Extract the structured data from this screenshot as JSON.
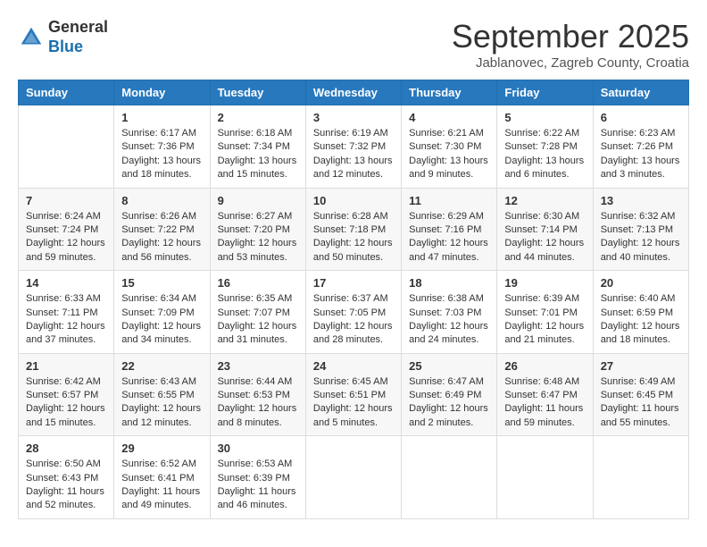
{
  "logo": {
    "line1": "General",
    "line2": "Blue"
  },
  "title": "September 2025",
  "subtitle": "Jablanovec, Zagreb County, Croatia",
  "days_header": [
    "Sunday",
    "Monday",
    "Tuesday",
    "Wednesday",
    "Thursday",
    "Friday",
    "Saturday"
  ],
  "weeks": [
    [
      {
        "day": "",
        "info": ""
      },
      {
        "day": "1",
        "info": "Sunrise: 6:17 AM\nSunset: 7:36 PM\nDaylight: 13 hours\nand 18 minutes."
      },
      {
        "day": "2",
        "info": "Sunrise: 6:18 AM\nSunset: 7:34 PM\nDaylight: 13 hours\nand 15 minutes."
      },
      {
        "day": "3",
        "info": "Sunrise: 6:19 AM\nSunset: 7:32 PM\nDaylight: 13 hours\nand 12 minutes."
      },
      {
        "day": "4",
        "info": "Sunrise: 6:21 AM\nSunset: 7:30 PM\nDaylight: 13 hours\nand 9 minutes."
      },
      {
        "day": "5",
        "info": "Sunrise: 6:22 AM\nSunset: 7:28 PM\nDaylight: 13 hours\nand 6 minutes."
      },
      {
        "day": "6",
        "info": "Sunrise: 6:23 AM\nSunset: 7:26 PM\nDaylight: 13 hours\nand 3 minutes."
      }
    ],
    [
      {
        "day": "7",
        "info": "Sunrise: 6:24 AM\nSunset: 7:24 PM\nDaylight: 12 hours\nand 59 minutes."
      },
      {
        "day": "8",
        "info": "Sunrise: 6:26 AM\nSunset: 7:22 PM\nDaylight: 12 hours\nand 56 minutes."
      },
      {
        "day": "9",
        "info": "Sunrise: 6:27 AM\nSunset: 7:20 PM\nDaylight: 12 hours\nand 53 minutes."
      },
      {
        "day": "10",
        "info": "Sunrise: 6:28 AM\nSunset: 7:18 PM\nDaylight: 12 hours\nand 50 minutes."
      },
      {
        "day": "11",
        "info": "Sunrise: 6:29 AM\nSunset: 7:16 PM\nDaylight: 12 hours\nand 47 minutes."
      },
      {
        "day": "12",
        "info": "Sunrise: 6:30 AM\nSunset: 7:14 PM\nDaylight: 12 hours\nand 44 minutes."
      },
      {
        "day": "13",
        "info": "Sunrise: 6:32 AM\nSunset: 7:13 PM\nDaylight: 12 hours\nand 40 minutes."
      }
    ],
    [
      {
        "day": "14",
        "info": "Sunrise: 6:33 AM\nSunset: 7:11 PM\nDaylight: 12 hours\nand 37 minutes."
      },
      {
        "day": "15",
        "info": "Sunrise: 6:34 AM\nSunset: 7:09 PM\nDaylight: 12 hours\nand 34 minutes."
      },
      {
        "day": "16",
        "info": "Sunrise: 6:35 AM\nSunset: 7:07 PM\nDaylight: 12 hours\nand 31 minutes."
      },
      {
        "day": "17",
        "info": "Sunrise: 6:37 AM\nSunset: 7:05 PM\nDaylight: 12 hours\nand 28 minutes."
      },
      {
        "day": "18",
        "info": "Sunrise: 6:38 AM\nSunset: 7:03 PM\nDaylight: 12 hours\nand 24 minutes."
      },
      {
        "day": "19",
        "info": "Sunrise: 6:39 AM\nSunset: 7:01 PM\nDaylight: 12 hours\nand 21 minutes."
      },
      {
        "day": "20",
        "info": "Sunrise: 6:40 AM\nSunset: 6:59 PM\nDaylight: 12 hours\nand 18 minutes."
      }
    ],
    [
      {
        "day": "21",
        "info": "Sunrise: 6:42 AM\nSunset: 6:57 PM\nDaylight: 12 hours\nand 15 minutes."
      },
      {
        "day": "22",
        "info": "Sunrise: 6:43 AM\nSunset: 6:55 PM\nDaylight: 12 hours\nand 12 minutes."
      },
      {
        "day": "23",
        "info": "Sunrise: 6:44 AM\nSunset: 6:53 PM\nDaylight: 12 hours\nand 8 minutes."
      },
      {
        "day": "24",
        "info": "Sunrise: 6:45 AM\nSunset: 6:51 PM\nDaylight: 12 hours\nand 5 minutes."
      },
      {
        "day": "25",
        "info": "Sunrise: 6:47 AM\nSunset: 6:49 PM\nDaylight: 12 hours\nand 2 minutes."
      },
      {
        "day": "26",
        "info": "Sunrise: 6:48 AM\nSunset: 6:47 PM\nDaylight: 11 hours\nand 59 minutes."
      },
      {
        "day": "27",
        "info": "Sunrise: 6:49 AM\nSunset: 6:45 PM\nDaylight: 11 hours\nand 55 minutes."
      }
    ],
    [
      {
        "day": "28",
        "info": "Sunrise: 6:50 AM\nSunset: 6:43 PM\nDaylight: 11 hours\nand 52 minutes."
      },
      {
        "day": "29",
        "info": "Sunrise: 6:52 AM\nSunset: 6:41 PM\nDaylight: 11 hours\nand 49 minutes."
      },
      {
        "day": "30",
        "info": "Sunrise: 6:53 AM\nSunset: 6:39 PM\nDaylight: 11 hours\nand 46 minutes."
      },
      {
        "day": "",
        "info": ""
      },
      {
        "day": "",
        "info": ""
      },
      {
        "day": "",
        "info": ""
      },
      {
        "day": "",
        "info": ""
      }
    ]
  ]
}
